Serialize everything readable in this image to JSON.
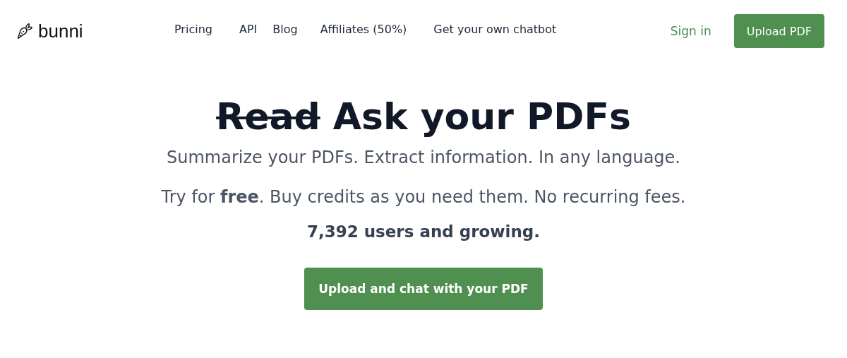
{
  "brand": {
    "name": "bunni"
  },
  "nav": {
    "links": [
      "Pricing",
      "API",
      "Blog",
      "Affiliates (50%)",
      "Get your own chatbot"
    ],
    "sign_in": "Sign in",
    "upload_button": "Upload PDF"
  },
  "hero": {
    "heading_struck": "Read",
    "heading": "Ask your PDFs",
    "subtitle": "Summarize your PDFs. Extract information. In any language.",
    "pricing_line": "Try for **free**. Buy credits as you need them. No recurring fees.",
    "users_line": "7,392 users and growing.",
    "cta_button": "Upload and chat with your PDF"
  }
}
